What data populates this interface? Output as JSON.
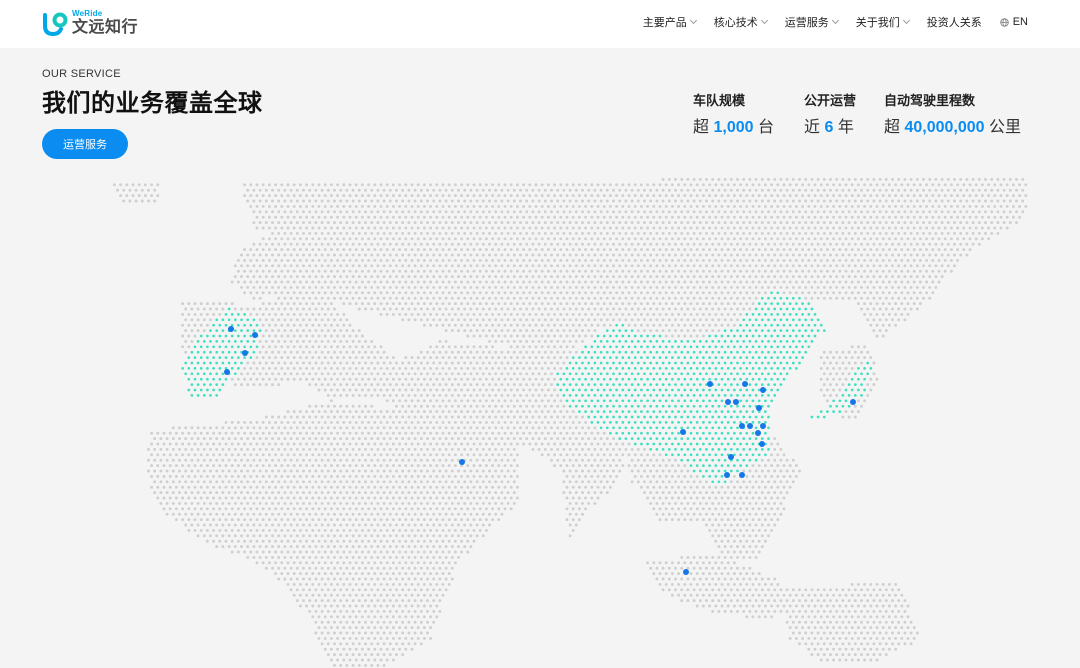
{
  "brand": {
    "name_en": "WeRide",
    "name_cn": "文远知行"
  },
  "nav": {
    "items": [
      {
        "label": "主要产品",
        "has_menu": true
      },
      {
        "label": "核心技术",
        "has_menu": true
      },
      {
        "label": "运营服务",
        "has_menu": true
      },
      {
        "label": "关于我们",
        "has_menu": true
      },
      {
        "label": "投资人关系",
        "has_menu": false
      }
    ],
    "lang": "EN"
  },
  "hero": {
    "eyebrow": "OUR SERVICE",
    "title": "我们的业务覆盖全球",
    "cta": "运营服务"
  },
  "stats": [
    {
      "label": "车队规模",
      "prefix": "超",
      "value": "1,000",
      "suffix": "台"
    },
    {
      "label": "公开运营",
      "prefix": "近",
      "value": "6",
      "suffix": "年"
    },
    {
      "label": "自动驾驶里程数",
      "prefix": "超",
      "value": "40,000,000",
      "suffix": "公里"
    }
  ],
  "colors": {
    "accent": "#0a8cf0",
    "coverage": "#3fe0c0",
    "marker": "#1677e8",
    "map_dot": "#cfcfcf",
    "background": "#f4f4f4"
  }
}
